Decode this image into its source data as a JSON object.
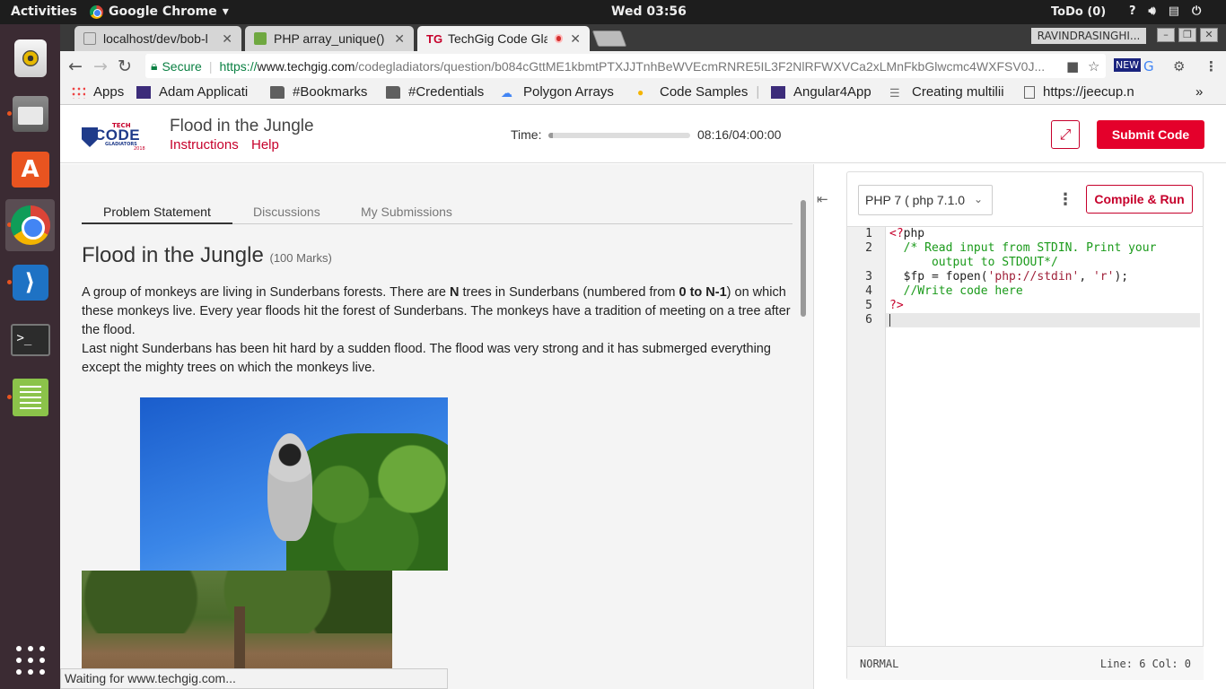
{
  "topbar": {
    "activities": "Activities",
    "app_menu": "Google Chrome",
    "clock": "Wed 03:56",
    "todo": "ToDo (0)",
    "tray_icons": [
      "help-icon",
      "volume-icon",
      "clipboard-icon",
      "power-icon"
    ]
  },
  "dock": {
    "items": [
      "rhythmbox-icon",
      "files-icon",
      "software-store-icon",
      "chrome-icon",
      "vscode-icon",
      "terminal-icon",
      "text-editor-icon",
      "show-apps-icon"
    ]
  },
  "browser": {
    "tabs": [
      {
        "title": "localhost/dev/bob-l"
      },
      {
        "title": "PHP array_unique()"
      },
      {
        "title": "TechGig Code Gla"
      }
    ],
    "user": "RAVINDRASINGHI...",
    "window_buttons": [
      "–",
      "❐",
      "✕"
    ],
    "omnibox": {
      "secure_label": "Secure",
      "scheme": "https://",
      "host": "www.techgig.com",
      "path": "/codegladiators/question/b084cGttME1kbmtPTXJJTnhBeWVEcmRNRE5IL3F2NlRFWXVCa2xLMnFkbGlwcmc4WXFSV0J..."
    },
    "bookmarks": [
      {
        "label": "Apps",
        "icon": "apps-grid-icon"
      },
      {
        "label": "Adam Applicati",
        "icon": "purple-site-icon"
      },
      {
        "label": "#Bookmarks",
        "icon": "folder-icon"
      },
      {
        "label": "#Credentials",
        "icon": "folder-icon"
      },
      {
        "label": "Polygon Arrays",
        "icon": "cloud-icon"
      },
      {
        "label": "Code Samples",
        "icon": "colorful-site-icon"
      },
      {
        "label": "Angular4App",
        "icon": "purple-site-icon"
      },
      {
        "label": "Creating multilii",
        "icon": "list-icon"
      },
      {
        "label": "https://jeecup.n",
        "icon": "page-icon"
      }
    ],
    "status_text": "Waiting for www.techgig.com..."
  },
  "header": {
    "logo": {
      "tech": "TECH",
      "code": "CODE",
      "gladiators": "GLADIATORS",
      "year": "2018"
    },
    "title": "Flood in the Jungle",
    "links": [
      "Instructions",
      "Help"
    ],
    "time_label": "Time:",
    "time_value": "08:16/04:00:00",
    "time_progress_percent": 3.4,
    "submit_label": "Submit Code"
  },
  "problem": {
    "tabs": [
      "Problem Statement",
      "Discussions",
      "My Submissions"
    ],
    "title": "Flood in the Jungle",
    "marks": "(100 Marks)",
    "para1_a": "A group of monkeys are living in Sunderbans forests.  There are ",
    "para1_b": "N",
    "para1_c": " trees in Sunderbans (numbered from ",
    "para1_d": "0 to N-1",
    "para1_e": ") on which these monkeys live. Every year floods hit the forest of Sunderbans. The monkeys have a tradition of meeting on a tree after the flood.",
    "para2": "Last night Sunderbans has been hit hard by a sudden flood. The flood was very strong and it has submerged everything except the mighty trees on which the monkeys live."
  },
  "editor": {
    "language": "PHP 7 ( php 7.1.0",
    "run_label": "Compile & Run",
    "gutter": [
      "1",
      "2",
      "",
      "3",
      "4",
      "5",
      "6"
    ],
    "code": {
      "l1_open": "<?",
      "l1_rest": "php",
      "l2": "  /* Read input from STDIN. Print your",
      "l2b": "      output to STDOUT*/",
      "l3_var": "  $fp = fopen(",
      "l3_s1": "'php://stdin'",
      "l3_mid": ", ",
      "l3_s2": "'r'",
      "l3_end": ");",
      "l4": "  //Write code here",
      "l5": "?>",
      "l6": ""
    },
    "mode": "NORMAL",
    "position": "Line: 6 Col: 0"
  }
}
